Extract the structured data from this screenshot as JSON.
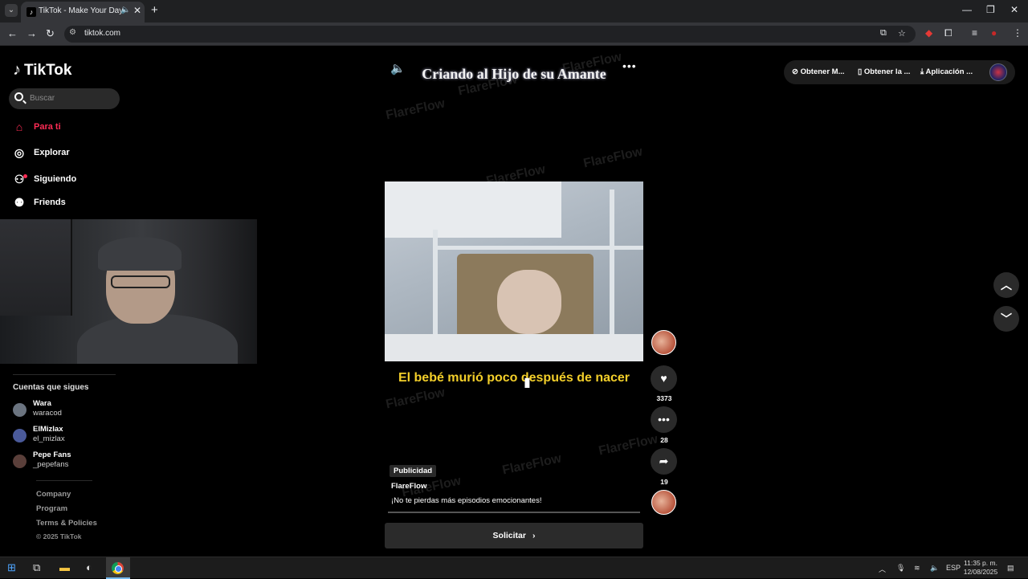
{
  "browser": {
    "tab_title": "TikTok - Make Your Day",
    "url": "tiktok.com"
  },
  "sidebar": {
    "logo": "TikTok",
    "search_placeholder": "Buscar",
    "nav": [
      {
        "label": "Para ti",
        "icon": "home-icon",
        "active": true
      },
      {
        "label": "Explorar",
        "icon": "compass-icon"
      },
      {
        "label": "Siguiendo",
        "icon": "following-icon"
      },
      {
        "label": "Friends",
        "icon": "friends-icon"
      }
    ],
    "following_title": "Cuentas que sigues",
    "accounts": [
      {
        "name": "Wara",
        "username": "waracod"
      },
      {
        "name": "ElMizlax",
        "username": "el_mizlax"
      },
      {
        "name": "Pepe Fans",
        "username": "_pepefans"
      }
    ],
    "footer_links": [
      "Company",
      "Program",
      "Terms & Policies"
    ],
    "copyright": "© 2025 TikTok"
  },
  "video": {
    "title": "Criando al Hijo de su Amante",
    "subtitle": "El bebé murió poco después de nacer",
    "watermark": "FlareFlow",
    "ad_badge": "Publicidad",
    "account": "FlareFlow",
    "description": "¡No te pierdas más episodios emocionantes!",
    "cta": "Solicitar",
    "likes": "3373",
    "comments": "28",
    "shares": "19"
  },
  "topbar": {
    "items": [
      "Obtener M...",
      "Obtener la ...",
      "Aplicación ..."
    ]
  },
  "taskbar": {
    "lang": "ESP",
    "time": "11:35 p. m.",
    "date": "12/08/2025"
  },
  "colors": {
    "accent": "#fe2c55",
    "subtitle": "#f3cf2a",
    "background": "#000000"
  }
}
